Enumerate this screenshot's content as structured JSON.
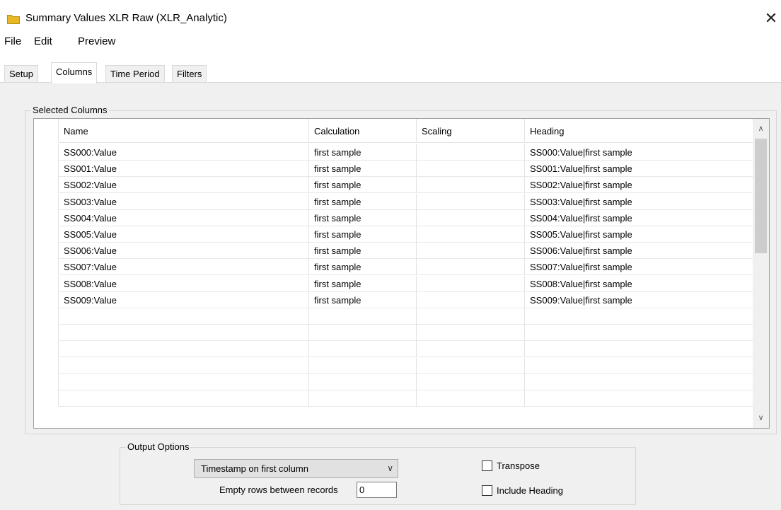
{
  "window": {
    "title": "Summary Values XLR Raw (XLR_Analytic)",
    "close_glyph": "✕",
    "folder_color": "#E8B923"
  },
  "menu": [
    "File",
    "Edit",
    "Preview"
  ],
  "tabs": [
    {
      "label": "Setup",
      "active": false
    },
    {
      "label": "Columns",
      "active": true
    },
    {
      "label": "Time Period",
      "active": false
    },
    {
      "label": "Filters",
      "active": false
    }
  ],
  "selected_columns": {
    "title": "Selected Columns",
    "headers": [
      "Name",
      "Calculation",
      "Scaling",
      "Heading"
    ],
    "rows": [
      {
        "name": "SS000:Value",
        "calc": "first sample",
        "scaling": "",
        "heading": "SS000:Value|first sample"
      },
      {
        "name": "SS001:Value",
        "calc": "first sample",
        "scaling": "",
        "heading": "SS001:Value|first sample"
      },
      {
        "name": "SS002:Value",
        "calc": "first sample",
        "scaling": "",
        "heading": "SS002:Value|first sample"
      },
      {
        "name": "SS003:Value",
        "calc": "first sample",
        "scaling": "",
        "heading": "SS003:Value|first sample"
      },
      {
        "name": "SS004:Value",
        "calc": "first sample",
        "scaling": "",
        "heading": "SS004:Value|first sample"
      },
      {
        "name": "SS005:Value",
        "calc": "first sample",
        "scaling": "",
        "heading": "SS005:Value|first sample"
      },
      {
        "name": "SS006:Value",
        "calc": "first sample",
        "scaling": "",
        "heading": "SS006:Value|first sample"
      },
      {
        "name": "SS007:Value",
        "calc": "first sample",
        "scaling": "",
        "heading": "SS007:Value|first sample"
      },
      {
        "name": "SS008:Value",
        "calc": "first sample",
        "scaling": "",
        "heading": "SS008:Value|first sample"
      },
      {
        "name": "SS009:Value",
        "calc": "first sample",
        "scaling": "",
        "heading": "SS009:Value|first sample"
      }
    ],
    "empty_rows": 6
  },
  "output_options": {
    "title": "Output Options",
    "timestamp_select": "Timestamp on first column",
    "empty_rows_label": "Empty rows between records",
    "empty_rows_value": "0",
    "transpose_label": "Transpose",
    "transpose_checked": false,
    "include_heading_label": "Include Heading",
    "include_heading_checked": false
  }
}
